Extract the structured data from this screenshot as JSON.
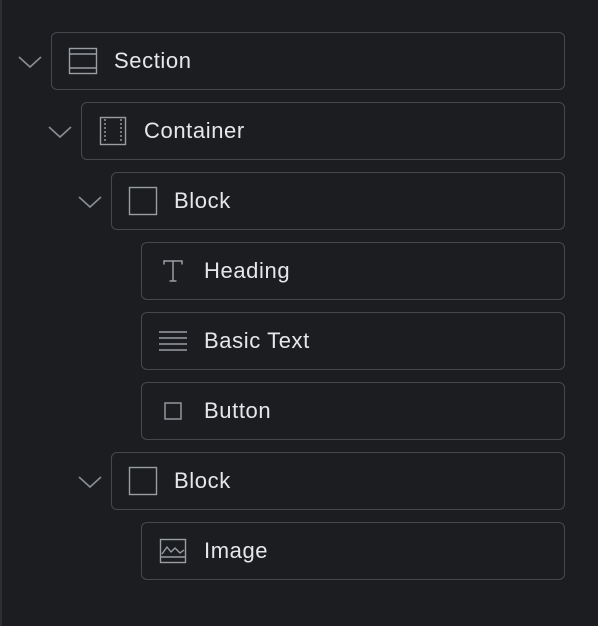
{
  "navigator": {
    "items": [
      {
        "label": "Section",
        "icon": "section-icon",
        "expanded": true
      },
      {
        "label": "Container",
        "icon": "container-icon",
        "expanded": true
      },
      {
        "label": "Block",
        "icon": "block-icon",
        "expanded": true
      },
      {
        "label": "Heading",
        "icon": "heading-icon"
      },
      {
        "label": "Basic Text",
        "icon": "paragraph-icon"
      },
      {
        "label": "Button",
        "icon": "button-icon"
      },
      {
        "label": "Block",
        "icon": "block-icon",
        "expanded": true
      },
      {
        "label": "Image",
        "icon": "image-icon"
      }
    ]
  },
  "colors": {
    "background": "#1b1d20",
    "border": "#45494e",
    "text": "#e6e7e9",
    "icon": "#9a9ea3"
  }
}
